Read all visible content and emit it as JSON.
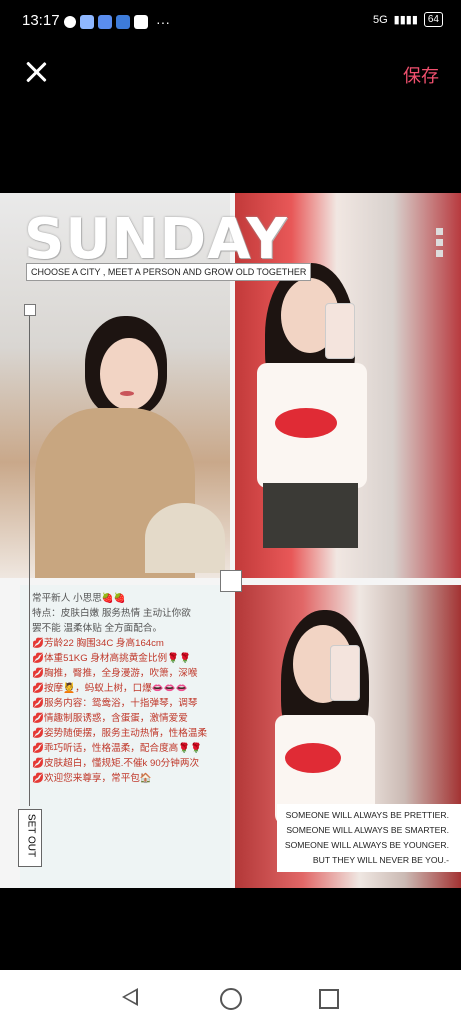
{
  "status": {
    "time": "13:17",
    "signal": "5G",
    "battery": "64",
    "more": "···"
  },
  "topbar": {
    "save": "保存"
  },
  "poster": {
    "title": "SUNDAY",
    "tagline": "CHOOSE A CITY ,  MEET A PERSON AND GROW OLD TOGETHER",
    "set_out": "SET OUT",
    "lines": [
      "常平新人 小思思🍓🍓",
      "特点：皮肤白嫩 服务热情 主动让你欲",
      "罢不能 温柔体贴 全方面配合。",
      "💋芳龄22 胸围34C 身高164cm",
      "💋体重51KG 身材高挑黄金比例🌹🌹",
      "💋胸推，臀推，全身漫游，吹箫，深喉",
      "💋按摩💆，蚂蚁上树，口爆👄👄👄",
      "💋服务内容：鸳鸯浴，十指弹琴，调琴",
      "💋情趣制服诱惑，含蛋蛋，激情爱爱",
      "💋姿势随便摆，服务主动热情，性格温柔",
      "💋乖巧听话，性格温柔，配合度高🌹🌹",
      "💋皮肤超白，懂规矩.不催k 90分钟两次",
      "💋欢迎您来尊享，常平包🏠"
    ],
    "quote": [
      "SOMEONE WILL ALWAYS BE PRETTIER.",
      "SOMEONE WILL ALWAYS BE SMARTER.",
      "SOMEONE WILL ALWAYS BE YOUNGER.",
      "BUT THEY WILL NEVER BE YOU.-"
    ]
  }
}
